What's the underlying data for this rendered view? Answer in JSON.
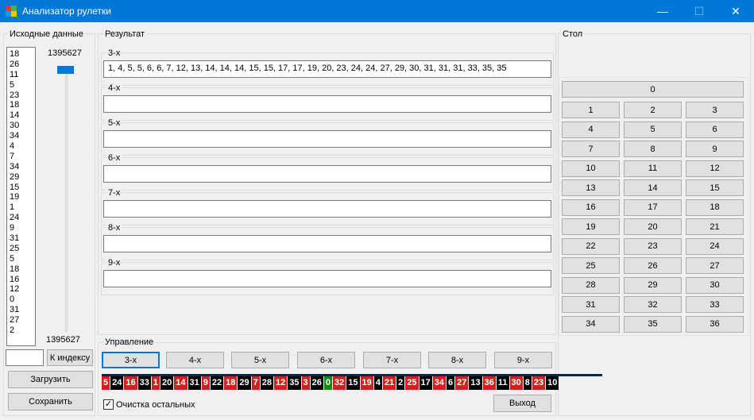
{
  "window": {
    "title": "Анализатор рулетки",
    "minimize": "—",
    "maximize": "☐",
    "close": "✕"
  },
  "source": {
    "title": "Исходные данные",
    "values": [
      "18",
      "26",
      "11",
      "5",
      "23",
      "18",
      "14",
      "30",
      "34",
      "4",
      "7",
      "34",
      "29",
      "15",
      "19",
      "1",
      "24",
      "9",
      "31",
      "25",
      "5",
      "18",
      "16",
      "12",
      "0",
      "31",
      "27",
      "2"
    ],
    "slider_top": "1395627",
    "slider_bottom": "1395627",
    "index_value": "",
    "index_button": "К индексу",
    "load_button": "Загрузить",
    "save_button": "Сохранить"
  },
  "result": {
    "title": "Результат",
    "groups": [
      {
        "label": "3-х",
        "value": "1, 4, 5, 5, 6, 6, 7, 12, 13, 14, 14, 14, 15, 15, 17, 17, 19, 20, 23, 24, 24, 27, 29, 30, 31, 31, 31, 33, 35, 35"
      },
      {
        "label": "4-х",
        "value": ""
      },
      {
        "label": "5-х",
        "value": ""
      },
      {
        "label": "6-х",
        "value": ""
      },
      {
        "label": "7-х",
        "value": ""
      },
      {
        "label": "8-х",
        "value": ""
      },
      {
        "label": "9-х",
        "value": ""
      }
    ]
  },
  "table": {
    "title": "Стол",
    "zero": "0",
    "numbers": [
      "1",
      "2",
      "3",
      "4",
      "5",
      "6",
      "7",
      "8",
      "9",
      "10",
      "11",
      "12",
      "13",
      "14",
      "15",
      "16",
      "17",
      "18",
      "19",
      "20",
      "21",
      "22",
      "23",
      "24",
      "25",
      "26",
      "27",
      "28",
      "29",
      "30",
      "31",
      "32",
      "33",
      "34",
      "35",
      "36"
    ]
  },
  "control": {
    "title": "Управление",
    "buttons": [
      "3-х",
      "4-х",
      "5-х",
      "6-х",
      "7-х",
      "8-х",
      "9-х"
    ],
    "checkbox_label": "Очистка остальных",
    "checked_mark": "✓",
    "exit_button": "Выход"
  },
  "strip": [
    {
      "n": "5",
      "c": "#d41f1f"
    },
    {
      "n": "24",
      "c": "#000000"
    },
    {
      "n": "16",
      "c": "#d41f1f"
    },
    {
      "n": "33",
      "c": "#000000"
    },
    {
      "n": "1",
      "c": "#d41f1f"
    },
    {
      "n": "20",
      "c": "#000000"
    },
    {
      "n": "14",
      "c": "#d41f1f"
    },
    {
      "n": "31",
      "c": "#000000"
    },
    {
      "n": "9",
      "c": "#d41f1f"
    },
    {
      "n": "22",
      "c": "#000000"
    },
    {
      "n": "18",
      "c": "#d41f1f"
    },
    {
      "n": "29",
      "c": "#000000"
    },
    {
      "n": "7",
      "c": "#d41f1f"
    },
    {
      "n": "28",
      "c": "#000000"
    },
    {
      "n": "12",
      "c": "#d41f1f"
    },
    {
      "n": "35",
      "c": "#000000"
    },
    {
      "n": "3",
      "c": "#d41f1f"
    },
    {
      "n": "26",
      "c": "#000000"
    },
    {
      "n": "0",
      "c": "#0f8a0f"
    },
    {
      "n": "32",
      "c": "#d41f1f"
    },
    {
      "n": "15",
      "c": "#000000"
    },
    {
      "n": "19",
      "c": "#d41f1f"
    },
    {
      "n": "4",
      "c": "#000000"
    },
    {
      "n": "21",
      "c": "#d41f1f"
    },
    {
      "n": "2",
      "c": "#000000"
    },
    {
      "n": "25",
      "c": "#d41f1f"
    },
    {
      "n": "17",
      "c": "#000000"
    },
    {
      "n": "34",
      "c": "#d41f1f"
    },
    {
      "n": "6",
      "c": "#000000"
    },
    {
      "n": "27",
      "c": "#d41f1f"
    },
    {
      "n": "13",
      "c": "#000000"
    },
    {
      "n": "36",
      "c": "#d41f1f"
    },
    {
      "n": "11",
      "c": "#000000"
    },
    {
      "n": "30",
      "c": "#d41f1f"
    },
    {
      "n": "8",
      "c": "#000000"
    },
    {
      "n": "23",
      "c": "#d41f1f"
    },
    {
      "n": "10",
      "c": "#000000"
    }
  ],
  "colors": {
    "accent": "#0078d7",
    "red": "#d41f1f",
    "black": "#000000",
    "green": "#0f8a0f"
  }
}
